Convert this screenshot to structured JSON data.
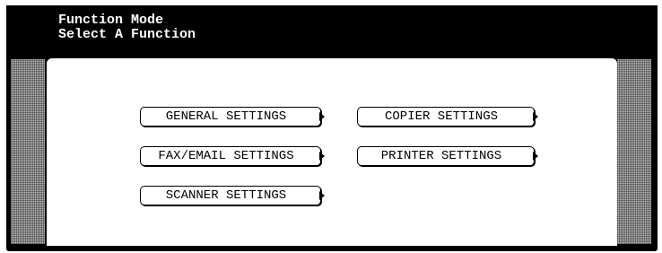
{
  "header": {
    "line1": "Function Mode",
    "line2": "Select A Function"
  },
  "menu": {
    "general_settings": "GENERAL SETTINGS",
    "copier_settings": "COPIER SETTINGS",
    "fax_email_settings": "FAX/EMAIL SETTINGS",
    "printer_settings": "PRINTER SETTINGS",
    "scanner_settings": "SCANNER SETTINGS"
  },
  "icons": {
    "submenu_arrow": "chevron-right-icon"
  },
  "colors": {
    "frame": "#000000",
    "panel": "#ffffff",
    "header_text": "#ffffff",
    "scrollbar": "#bdbdbd"
  }
}
